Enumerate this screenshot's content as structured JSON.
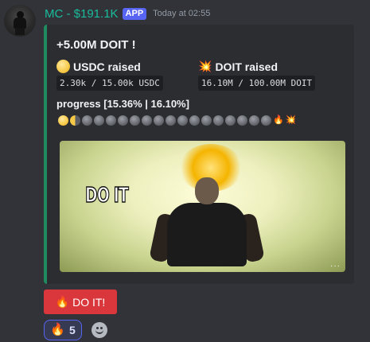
{
  "message": {
    "username": "MC - $191.1K",
    "badge": "APP",
    "timestamp": "Today at 02:55"
  },
  "embed": {
    "title": "+5.00M DOIT !",
    "fields": [
      {
        "name": "USDC raised",
        "icon": "coin-icon",
        "value": "2.30k / 15.00k USDC"
      },
      {
        "name": "DOIT raised",
        "icon": "collision-icon",
        "value": "16.10M / 100.00M DOIT"
      }
    ],
    "progress_label": "progress [15.36% | 16.10%]",
    "progress_segments": [
      "full",
      "half",
      "empty",
      "empty",
      "empty",
      "empty",
      "empty",
      "empty",
      "empty",
      "empty",
      "empty",
      "empty",
      "empty",
      "empty",
      "empty",
      "empty",
      "empty",
      "empty",
      "fire",
      "collision"
    ],
    "progress_usdc_fraction": 0.1536,
    "progress_doit_fraction": 0.161,
    "media_caption": "DO IT"
  },
  "action_button": {
    "label": "DO IT!",
    "icon": "fire-icon",
    "color": "#da373c"
  },
  "reactions": [
    {
      "emoji": "🔥",
      "count": "5"
    }
  ],
  "colors": {
    "username": "#1abc9c",
    "badge": "#5865f2",
    "embed_border": "#1f8b5f",
    "background": "#313338"
  }
}
